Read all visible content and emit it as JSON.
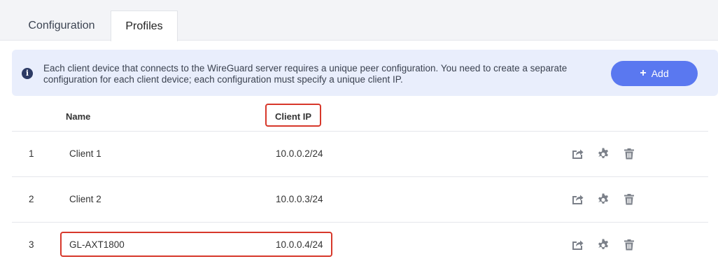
{
  "tabs": [
    {
      "label": "Configuration",
      "active": false
    },
    {
      "label": "Profiles",
      "active": true
    }
  ],
  "banner": {
    "icon": "info-icon",
    "text": "Each client device that connects to the WireGuard server requires a unique peer configuration. You need to create a separate configuration for each client device; each configuration must specify a unique client IP.",
    "add_label": "Add"
  },
  "table": {
    "headers": {
      "name": "Name",
      "client_ip": "Client IP"
    },
    "rows": [
      {
        "index": "1",
        "name": "Client 1",
        "ip": "10.0.0.2/24"
      },
      {
        "index": "2",
        "name": "Client 2",
        "ip": "10.0.0.3/24"
      },
      {
        "index": "3",
        "name": "GL-AXT1800",
        "ip": "10.0.0.4/24"
      }
    ],
    "actions": [
      "export-icon",
      "gear-icon",
      "trash-icon"
    ]
  },
  "colors": {
    "accent": "#5a78f0",
    "banner_bg": "#e9eefc",
    "highlight": "#d7382b",
    "icon_gray": "#7b8089"
  }
}
